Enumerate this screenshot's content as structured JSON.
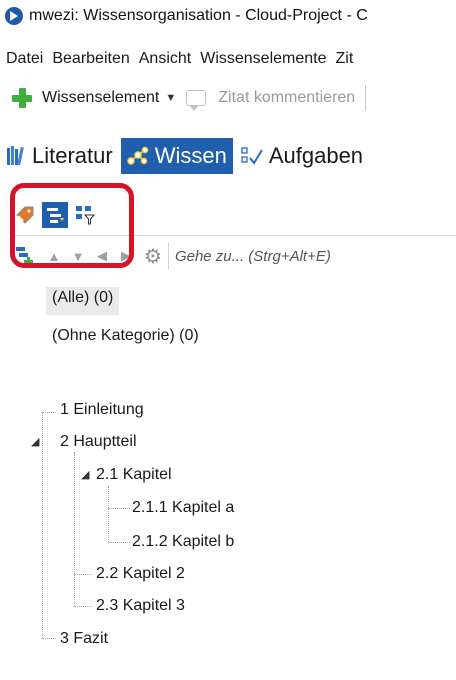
{
  "window": {
    "title": "mwezi: Wissensorganisation - Cloud-Project - C"
  },
  "menu": [
    "Datei",
    "Bearbeiten",
    "Ansicht",
    "Wissenselemente",
    "Zit"
  ],
  "toolbar": {
    "new_element_label": "Wissenselement",
    "comment_label": "Zitat kommentieren"
  },
  "module_tabs": [
    {
      "label": "Literatur",
      "active": false
    },
    {
      "label": "Wissen",
      "active": true
    },
    {
      "label": "Aufgaben",
      "active": false
    }
  ],
  "goto": {
    "placeholder": "Gehe zu... (Strg+Alt+E)"
  },
  "categories": [
    "(Alle) (0)",
    "(Ohne Kategorie) (0)"
  ],
  "tree": [
    {
      "label": "1 Einleitung"
    },
    {
      "label": "2 Hauptteil",
      "expanded": true
    },
    {
      "label": "2.1 Kapitel",
      "expanded": true
    },
    {
      "label": "2.1.1 Kapitel a"
    },
    {
      "label": "2.1.2 Kapitel b"
    },
    {
      "label": "2.2 Kapitel 2"
    },
    {
      "label": "2.3 Kapitel 3"
    },
    {
      "label": "3 Fazit"
    }
  ],
  "colors": {
    "accent": "#1f5fad",
    "highlight": "#d4142b",
    "add_green": "#3fae3f"
  }
}
